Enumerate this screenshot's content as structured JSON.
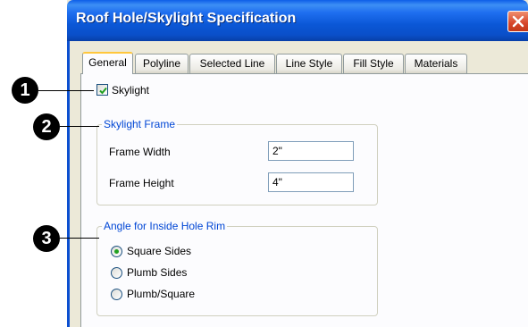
{
  "window": {
    "title": "Roof Hole/Skylight Specification",
    "close_icon": "close-icon"
  },
  "tabs": [
    {
      "label": "General",
      "active": true
    },
    {
      "label": "Polyline",
      "active": false
    },
    {
      "label": "Selected Line",
      "active": false
    },
    {
      "label": "Line Style",
      "active": false
    },
    {
      "label": "Fill Style",
      "active": false
    },
    {
      "label": "Materials",
      "active": false
    }
  ],
  "skylight": {
    "label": "Skylight",
    "checked": true
  },
  "frame_group": {
    "title": "Skylight Frame",
    "width_label": "Frame Width",
    "width_value": "2\"",
    "height_label": "Frame Height",
    "height_value": "4\""
  },
  "angle_group": {
    "title": "Angle for Inside Hole Rim",
    "options": [
      "Square Sides",
      "Plumb Sides",
      "Plumb/Square"
    ],
    "selected": "Square Sides"
  },
  "callouts": [
    "1",
    "2",
    "3"
  ],
  "colors": {
    "titlebar": "#0b57d6",
    "dialog_bg": "#ece9d8",
    "group_title": "#0046d5",
    "active_tab_highlight": "#ffc73c",
    "radio_dot": "#21a121"
  }
}
